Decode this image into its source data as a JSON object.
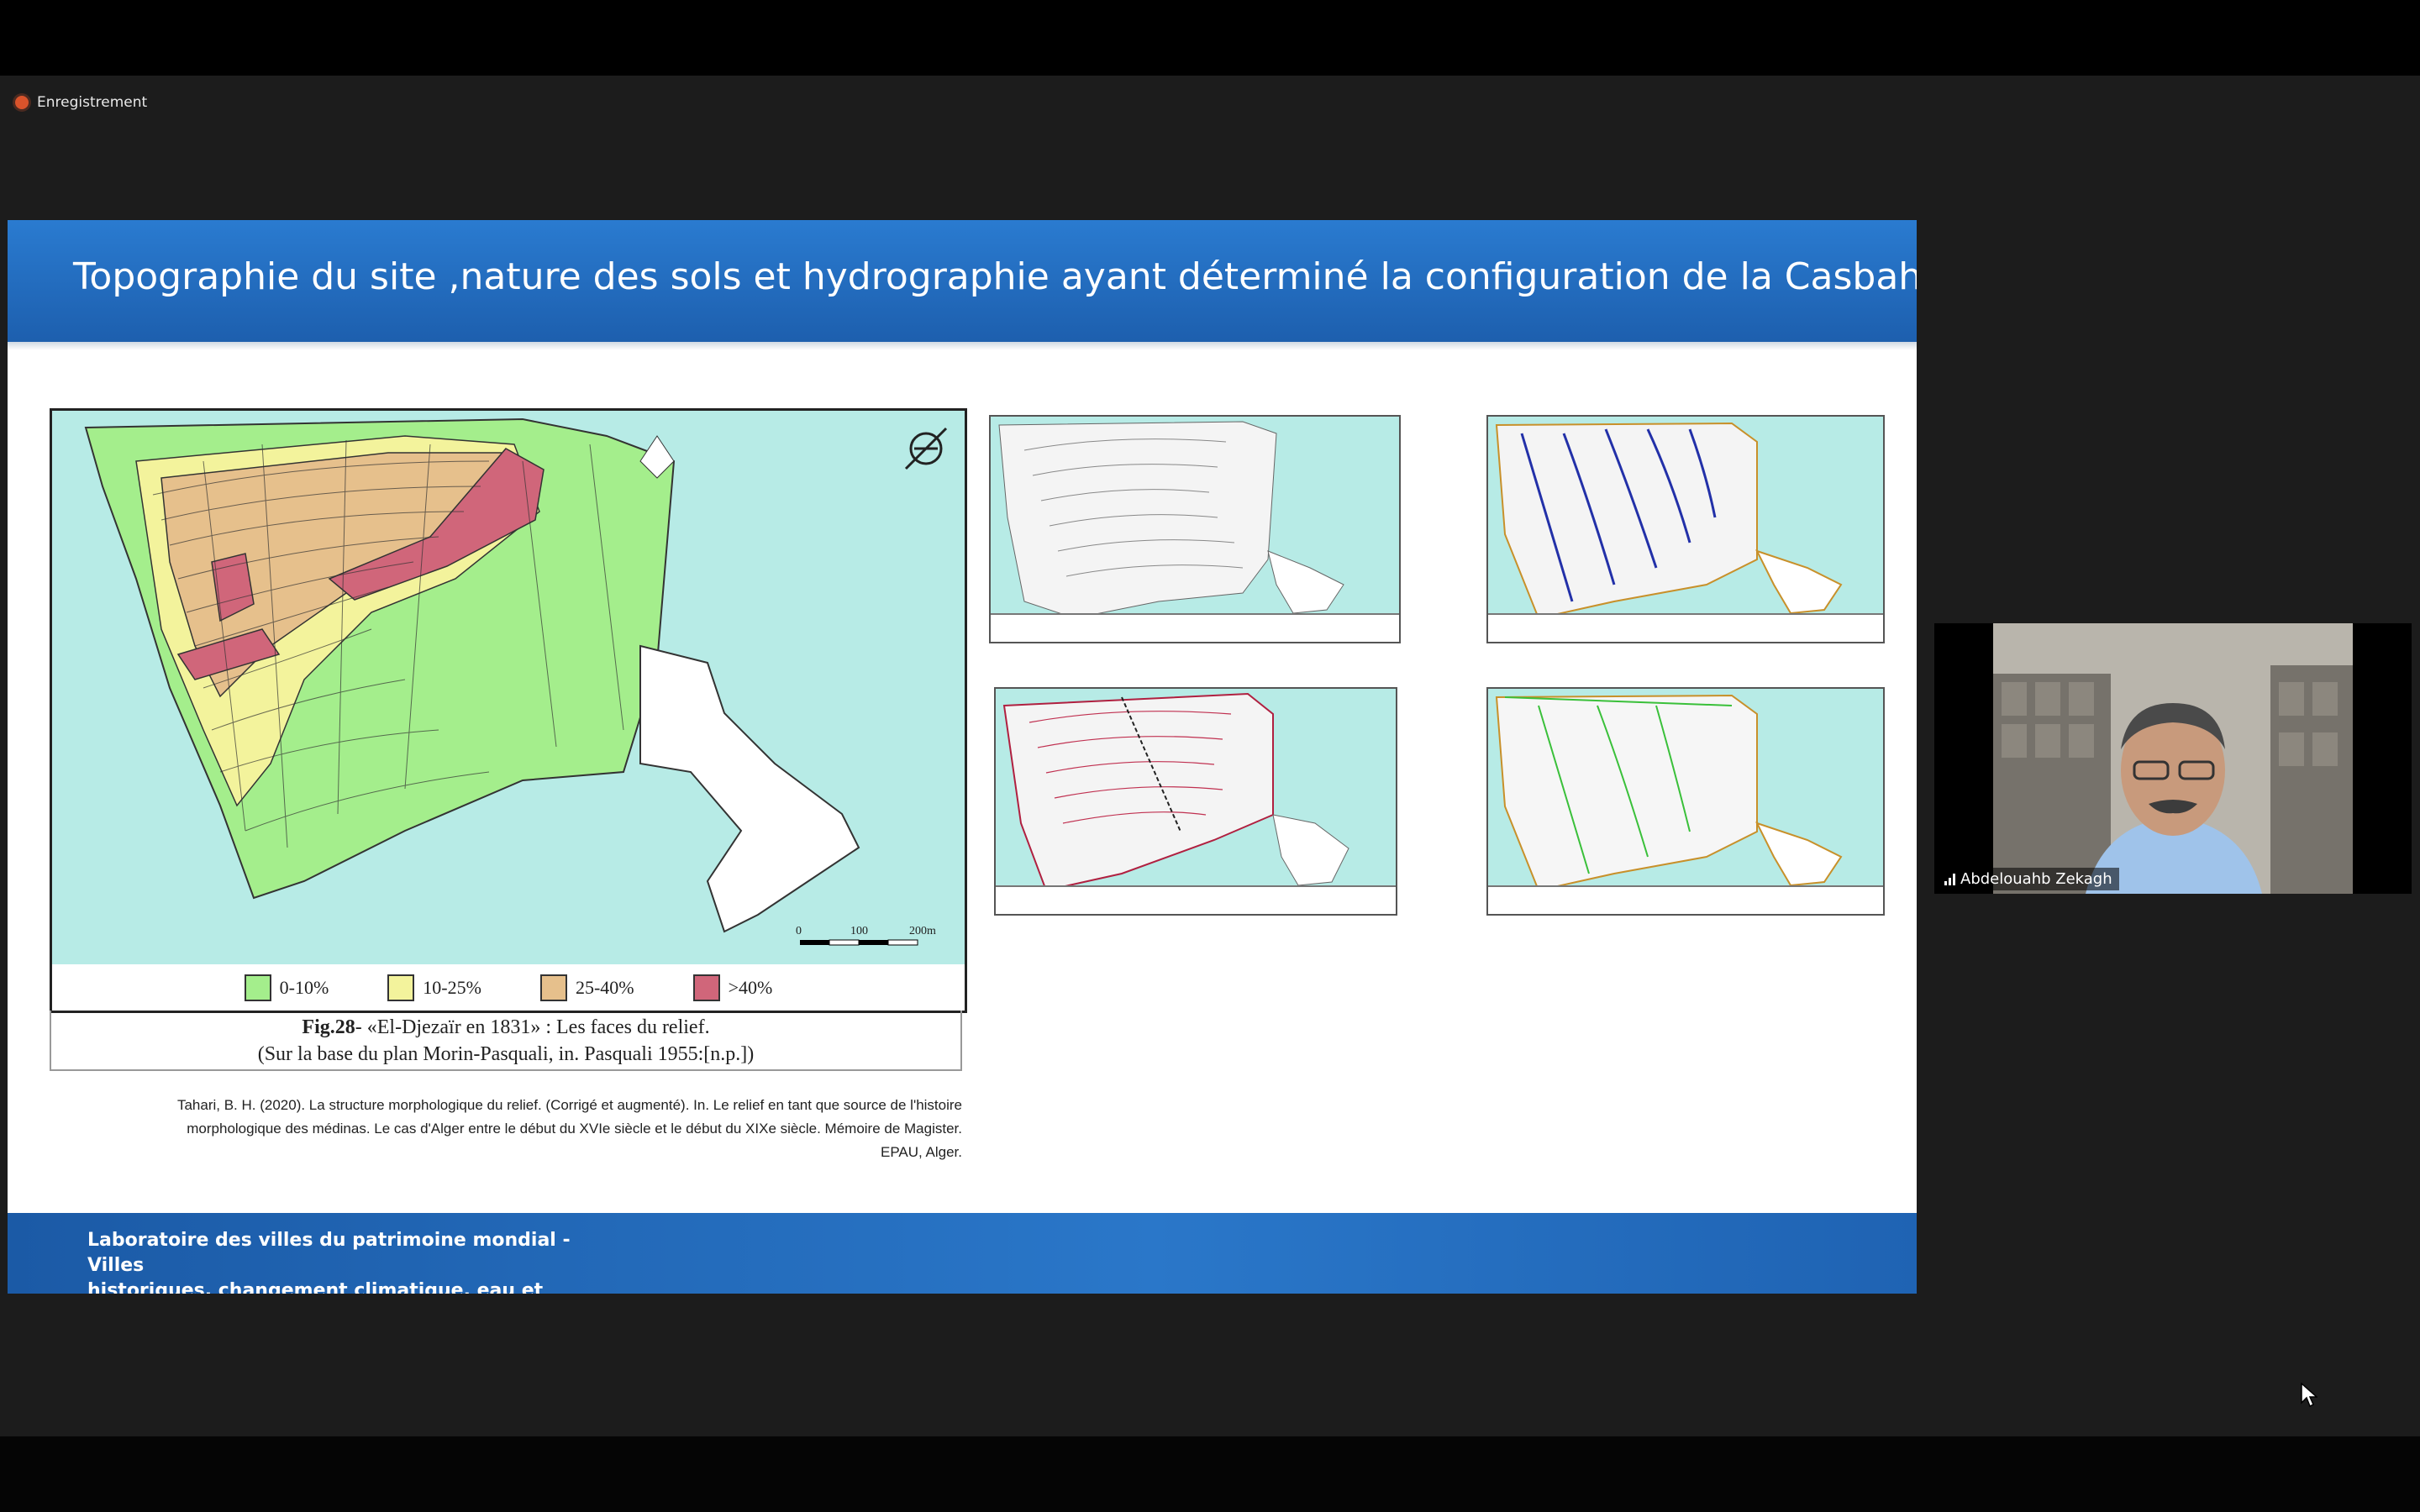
{
  "recording": {
    "label": "Enregistrement"
  },
  "slide": {
    "title": "Topographie du site ,nature des sols et hydrographie ayant déterminé la configuration de la Casbah",
    "footer_line1": "Laboratoire des villes du patrimoine mondial - Villes",
    "footer_line2": "historiques, changement climatique, eau et énergie",
    "legend": [
      {
        "label": "0-10%",
        "color": "#a4ee8c"
      },
      {
        "label": "10-25%",
        "color": "#f3f39c"
      },
      {
        "label": "25-40%",
        "color": "#e6c08c"
      },
      {
        "label": ">40%",
        "color": "#d0667a"
      }
    ],
    "map_scale": {
      "zero": "0",
      "mid": "100",
      "end": "200m"
    },
    "caption_fig": "Fig.28",
    "caption_line1": "- «El-Djezaïr en 1831» : Les faces du relief.",
    "caption_line2": "(Sur la base du plan Morin-Pasquali, in. Pasquali 1955:[n.p.])",
    "source_line1": "Tahari, B. H. (2020). La structure morphologique du relief. (Corrigé et augmenté). In. Le relief en tant que source de l'histoire",
    "source_line2": "morphologique des médinas. Le cas d'Alger entre le début du XVIe siècle et le début du XIXe siècle. Mémoire de Magister.",
    "source_line3": "EPAU, Alger."
  },
  "participant": {
    "name": "Abdelouahb Zekagh"
  },
  "colors": {
    "header_blue": "#2a7bd0",
    "footer_blue": "#1b5aa6",
    "sea": "#b7ebe6",
    "recording_dot": "#d9532b"
  }
}
